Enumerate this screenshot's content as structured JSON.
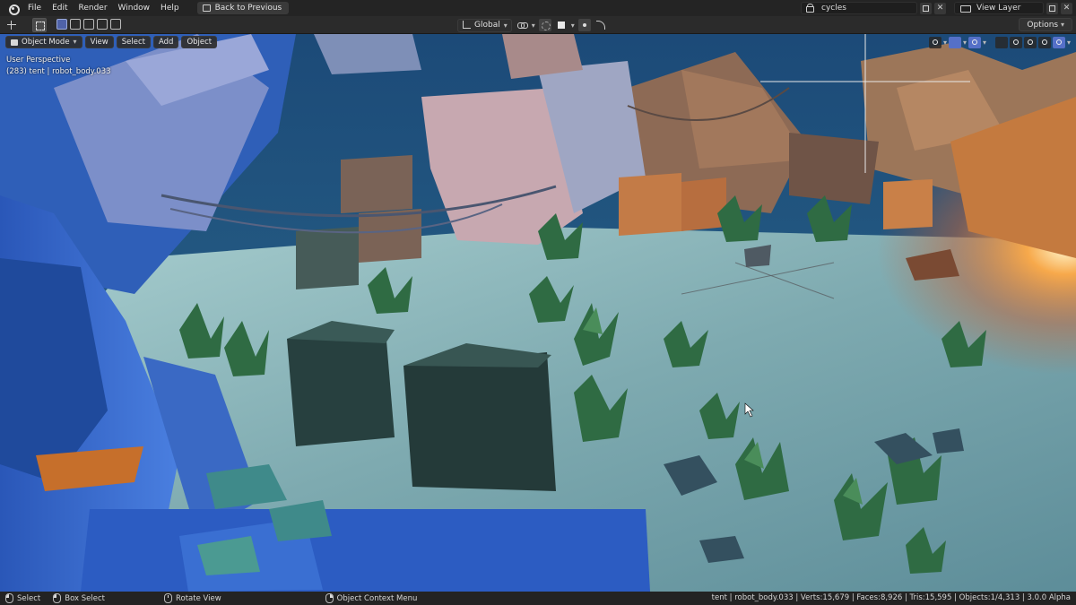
{
  "topbar": {
    "menu": [
      "File",
      "Edit",
      "Render",
      "Window",
      "Help"
    ],
    "back_button": "Back to Previous",
    "scene_name": "cycles",
    "view_layer": "View Layer"
  },
  "header": {
    "orientation": "Global",
    "options_label": "Options"
  },
  "viewport": {
    "mode": "Object Mode",
    "menus": [
      "View",
      "Select",
      "Add",
      "Object"
    ],
    "perspective_label": "User Perspective",
    "object_info": "(283) tent | robot_body.033"
  },
  "statusbar": {
    "select": "Select",
    "box_select": "Box Select",
    "rotate_view": "Rotate View",
    "context_menu": "Object Context Menu",
    "stats": "tent | robot_body.033 | Verts:15,679 | Faces:8,926 | Tris:15,595 | Objects:1/4,313 | 3.0.0 Alpha"
  },
  "colors": {
    "accent_blue": "#5570c8",
    "ui_dark": "#242424",
    "header_bg": "#2b2b2b",
    "sky_blue": "#1f4f7d",
    "ground": "#8fb5b6",
    "warm_light": "#f2a24a"
  }
}
